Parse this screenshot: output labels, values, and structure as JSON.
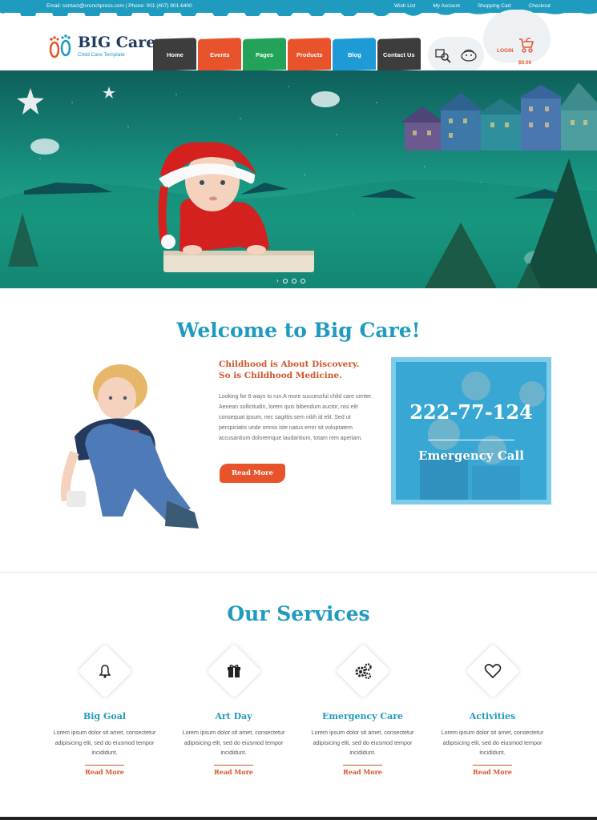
{
  "topbar": {
    "contact": "Email: contact@crunchpress.com | Phone: 001 (407) 901-6400",
    "links": [
      "Wish List",
      "My Account",
      "Shopping Cart",
      "Checkout"
    ]
  },
  "brand": {
    "title": "BIG Care",
    "tagline": "Child Care Template"
  },
  "nav": [
    {
      "label": "Home",
      "color": "#3d3d3d"
    },
    {
      "label": "Events",
      "color": "#e8532b"
    },
    {
      "label": "Pages",
      "color": "#23a25a"
    },
    {
      "label": "Products",
      "color": "#e8532b"
    },
    {
      "label": "Blog",
      "color": "#1e9bd6"
    },
    {
      "label": "Contact Us",
      "color": "#3d3d3d"
    }
  ],
  "header": {
    "login": "LOGIN",
    "cart_total": "$0.00"
  },
  "hero": {
    "slider_prev": "›"
  },
  "welcome": {
    "title": "Welcome to Big Care!",
    "subtitle": "Childhood is About Discovery. So is Childhood Medicine.",
    "body": "Looking for 6 ways to run.A more successful child care center. Aenean sollicitudin, lorem quis bibendum auctor, nisi elit consequat ipsum, nec sagittis sem nibh id elit. Sed ut perspiciatis unde omnis iste natus error sit voluptatem accusantium doloremque laudantium, totam rem aperiam.",
    "read_more": "Read More"
  },
  "emergency": {
    "number": "222-77-124",
    "label": "Emergency Call"
  },
  "services": {
    "title": "Our Services",
    "items": [
      {
        "title": "Big Goal",
        "icon": "bell-icon",
        "text": "Lorem ipsum dolor sit amet, consectetur adipisicing elit, sed do eiusmod tempor incididunt.",
        "link": "Read More"
      },
      {
        "title": "Art Day",
        "icon": "gift-icon",
        "text": "Lorem ipsum dolor sit amet, consectetur adipisicing elit, sed do eiusmod tempor incididunt.",
        "link": "Read More"
      },
      {
        "title": "Emergency Care",
        "icon": "gears-icon",
        "text": "Lorem ipsum dolor sit amet, consectetur adipisicing elit, sed do eiusmod tempor incididunt.",
        "link": "Read More"
      },
      {
        "title": "Activities",
        "icon": "heart-icon",
        "text": "Lorem ipsum dolor sit amet, consectetur adipisicing elit, sed do eiusmod tempor incididunt.",
        "link": "Read More"
      }
    ]
  }
}
